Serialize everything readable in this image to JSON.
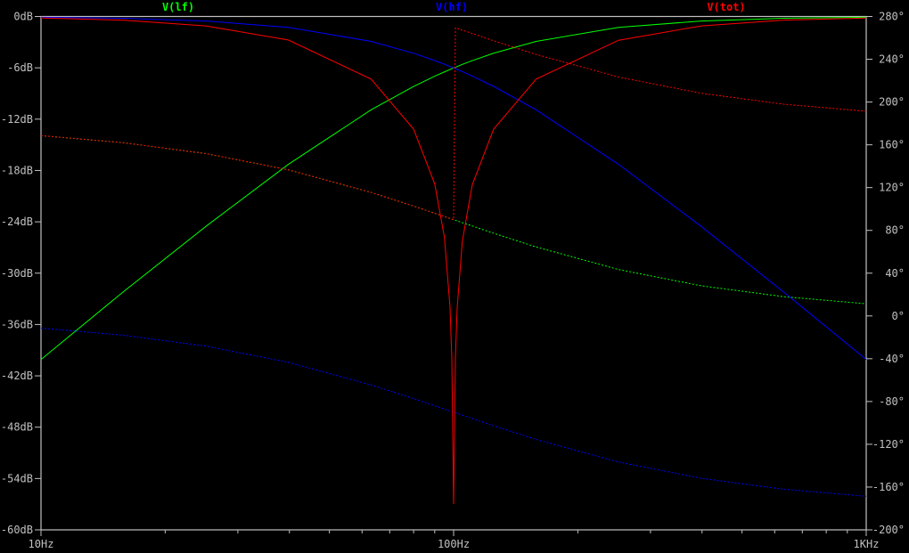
{
  "chart_data": {
    "type": "line",
    "title": "",
    "x_scale": "log",
    "xlim": [
      10,
      1000
    ],
    "x_ticks": [
      {
        "value": 10,
        "label": "10Hz"
      },
      {
        "value": 100,
        "label": "100Hz"
      },
      {
        "value": 1000,
        "label": "1KHz"
      }
    ],
    "left_axis": {
      "unit": "dB",
      "ylim": [
        -60,
        0
      ],
      "ticks": [
        {
          "value": 0,
          "label": "0dB"
        },
        {
          "value": -6,
          "label": "-6dB"
        },
        {
          "value": -12,
          "label": "-12dB"
        },
        {
          "value": -18,
          "label": "-18dB"
        },
        {
          "value": -24,
          "label": "-24dB"
        },
        {
          "value": -30,
          "label": "-30dB"
        },
        {
          "value": -36,
          "label": "-36dB"
        },
        {
          "value": -42,
          "label": "-42dB"
        },
        {
          "value": -48,
          "label": "-48dB"
        },
        {
          "value": -54,
          "label": "-54dB"
        },
        {
          "value": -60,
          "label": "-60dB"
        }
      ]
    },
    "right_axis": {
      "unit": "degrees",
      "ylim": [
        -200,
        280
      ],
      "ticks": [
        {
          "value": 280,
          "label": "280°"
        },
        {
          "value": 240,
          "label": "240°"
        },
        {
          "value": 200,
          "label": "200°"
        },
        {
          "value": 160,
          "label": "160°"
        },
        {
          "value": 120,
          "label": "120°"
        },
        {
          "value": 80,
          "label": "80°"
        },
        {
          "value": 40,
          "label": "40°"
        },
        {
          "value": 0,
          "label": "0°"
        },
        {
          "value": -40,
          "label": "-40°"
        },
        {
          "value": -80,
          "label": "-80°"
        },
        {
          "value": -120,
          "label": "-120°"
        },
        {
          "value": -160,
          "label": "-160°"
        },
        {
          "value": -200,
          "label": "-200°"
        }
      ]
    },
    "grid": false,
    "legend_position": "top",
    "x": [
      10,
      15.8,
      25.1,
      39.8,
      63.1,
      80,
      90,
      95,
      98,
      99,
      100,
      101,
      102,
      105,
      111,
      125,
      158.5,
      251,
      398,
      631,
      1000
    ],
    "series": [
      {
        "name": "V(lf)",
        "color": "#00ff00",
        "magnitude_db": [
          -40.09,
          -32.21,
          -24.53,
          -17.27,
          -10.91,
          -8.18,
          -6.98,
          -6.48,
          -6.2,
          -6.1,
          -6.02,
          -5.94,
          -5.85,
          -5.6,
          -5.16,
          -4.29,
          -2.91,
          -1.28,
          -0.53,
          -0.21,
          -0.09
        ],
        "phase_deg": [
          168.6,
          162.0,
          151.8,
          136.6,
          115.5,
          102.7,
          96.0,
          92.9,
          91.2,
          90.6,
          90,
          89.4,
          88.9,
          87.2,
          84.1,
          77.3,
          64.5,
          43.4,
          28.2,
          18.0,
          11.4
        ]
      },
      {
        "name": "V(hf)",
        "color": "#0000ff",
        "magnitude_db": [
          -0.09,
          -0.21,
          -0.53,
          -1.27,
          -2.91,
          -4.3,
          -5.15,
          -5.59,
          -5.85,
          -5.93,
          -6.02,
          -6.11,
          -6.19,
          -6.45,
          -6.97,
          -8.17,
          -10.91,
          -17.28,
          -24.53,
          -32.21,
          -40.09
        ],
        "phase_deg": [
          -11.4,
          -18.0,
          -28.2,
          -43.4,
          -64.5,
          -77.3,
          -84.0,
          -87.1,
          -88.8,
          -89.4,
          -90,
          -90.6,
          -91.1,
          -92.8,
          -95.9,
          -102.7,
          -115.5,
          -136.6,
          -151.8,
          -162.0,
          -168.6
        ]
      },
      {
        "name": "V(tot)",
        "color": "#ff0000",
        "magnitude_db": [
          -0.17,
          -0.43,
          -1.1,
          -2.76,
          -7.32,
          -13.17,
          -19.57,
          -25.81,
          -33.9,
          -39.95,
          -57,
          -40.05,
          -34.06,
          -26.24,
          -19.66,
          -13.17,
          -7.32,
          -2.78,
          -1.1,
          -0.43,
          -0.18
        ],
        "phase_deg": [
          168.6,
          162.0,
          151.8,
          136.6,
          115.5,
          102.7,
          96.0,
          92.9,
          91.2,
          90.6,
          90,
          269.4,
          268.9,
          267.2,
          264.1,
          257.3,
          244.5,
          223.4,
          208.2,
          198.0,
          191.4
        ]
      }
    ]
  }
}
